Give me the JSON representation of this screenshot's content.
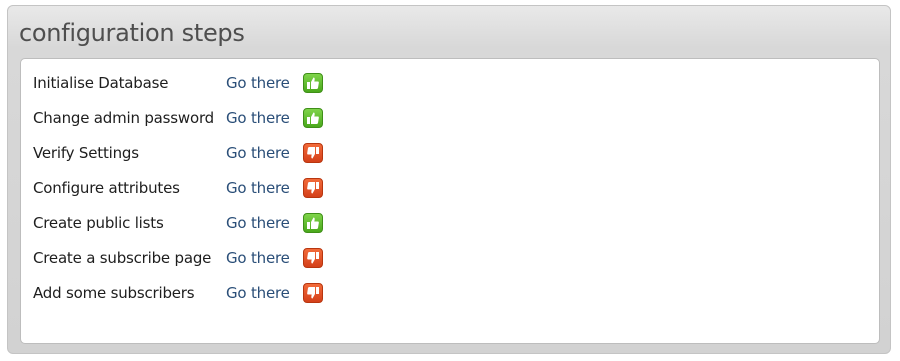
{
  "panel": {
    "title": "configuration steps"
  },
  "steps": [
    {
      "label": "Initialise Database",
      "link": "Go there",
      "status": "done",
      "icon": "thumbs-up-icon"
    },
    {
      "label": "Change admin password",
      "link": "Go there",
      "status": "done",
      "icon": "thumbs-up-icon"
    },
    {
      "label": "Verify Settings",
      "link": "Go there",
      "status": "not-done",
      "icon": "thumbs-down-icon"
    },
    {
      "label": "Configure attributes",
      "link": "Go there",
      "status": "not-done",
      "icon": "thumbs-down-icon"
    },
    {
      "label": "Create public lists",
      "link": "Go there",
      "status": "done",
      "icon": "thumbs-up-icon"
    },
    {
      "label": "Create a subscribe page",
      "link": "Go there",
      "status": "not-done",
      "icon": "thumbs-down-icon"
    },
    {
      "label": "Add some subscribers",
      "link": "Go there",
      "status": "not-done",
      "icon": "thumbs-down-icon"
    }
  ],
  "colors": {
    "done": "#5cbf2a",
    "not_done": "#e0522a",
    "link": "#2a4e78"
  }
}
